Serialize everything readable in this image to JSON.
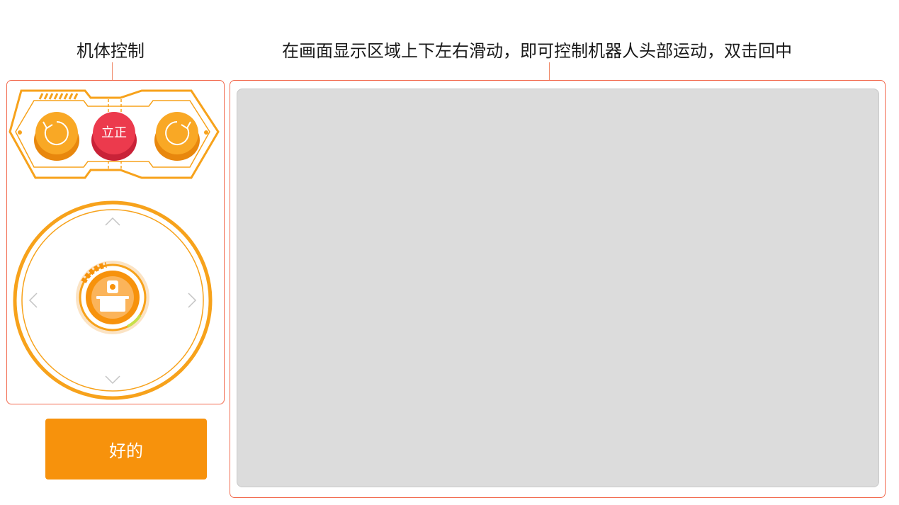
{
  "labels": {
    "body_control": "机体控制",
    "head_control_hint": "在画面显示区域上下左右滑动，即可控制机器人头部运动，双击回中"
  },
  "body_panel": {
    "stand_button_label": "立正",
    "rotate_left_icon": "rotate-ccw-icon",
    "rotate_right_icon": "rotate-cw-icon",
    "joystick_icons": [
      "chevron-up-icon",
      "chevron-down-icon",
      "chevron-left-icon",
      "chevron-right-icon",
      "robot-icon"
    ]
  },
  "ok_button": {
    "label": "好的"
  },
  "colors": {
    "accent_orange": "#f7920c",
    "frame_orange": "#f26b4f",
    "stand_red": "#ec3a4d",
    "video_bg": "#dcdcdc"
  }
}
